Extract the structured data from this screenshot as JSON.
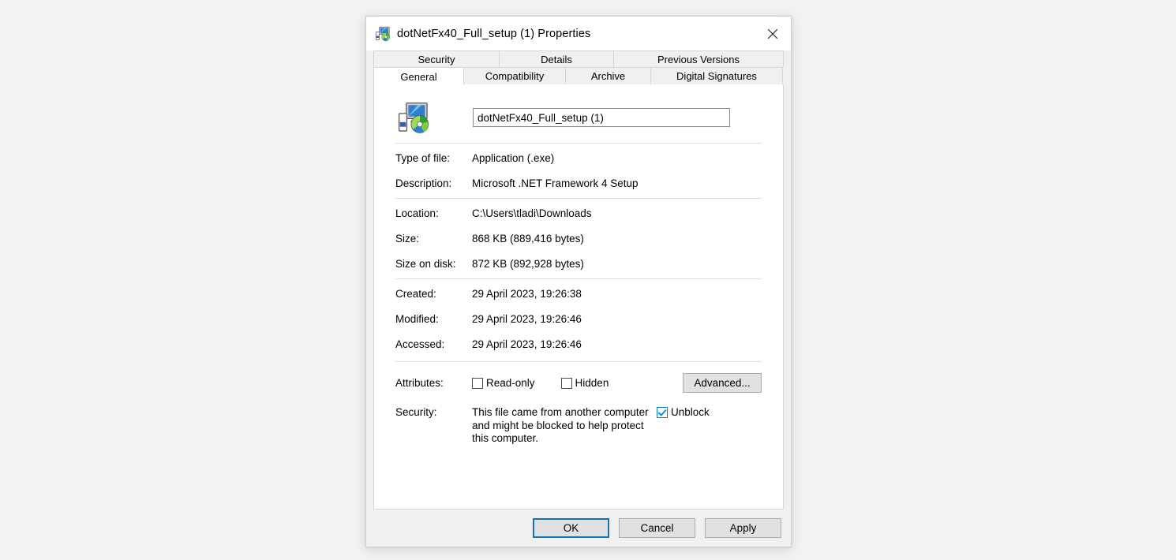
{
  "window": {
    "title": "dotNetFx40_Full_setup (1) Properties",
    "icon": "setup-application-icon",
    "close_label": "✕",
    "accent_color": "#1172b8"
  },
  "tabs": {
    "row1": [
      {
        "label": "Security",
        "active": false
      },
      {
        "label": "Details",
        "active": false
      },
      {
        "label": "Previous Versions",
        "active": false
      }
    ],
    "row2": [
      {
        "label": "General",
        "active": true
      },
      {
        "label": "Compatibility",
        "active": false
      },
      {
        "label": "Archive",
        "active": false
      },
      {
        "label": "Digital Signatures",
        "active": false
      }
    ]
  },
  "general": {
    "filename_value": "dotNetFx40_Full_setup (1)",
    "properties": [
      {
        "label": "Type of file:",
        "value": "Application (.exe)"
      },
      {
        "label": "Description:",
        "value": "Microsoft .NET Framework 4 Setup"
      },
      {
        "label": "Location:",
        "value": "C:\\Users\\tladi\\Downloads"
      },
      {
        "label": "Size:",
        "value": "868 KB (889,416 bytes)"
      },
      {
        "label": "Size on disk:",
        "value": "872 KB (892,928 bytes)"
      },
      {
        "label": "Created:",
        "value": "29 April 2023, 19:26:38"
      },
      {
        "label": "Modified:",
        "value": "29 April 2023, 19:26:46"
      },
      {
        "label": "Accessed:",
        "value": "29 April 2023, 19:26:46"
      }
    ],
    "attributes": {
      "label": "Attributes:",
      "readonly_label": "Read-only",
      "readonly_checked": false,
      "hidden_label": "Hidden",
      "hidden_checked": false,
      "advanced_label": "Advanced..."
    },
    "security": {
      "label": "Security:",
      "message": "This file came from another computer and might be blocked to help protect this computer.",
      "unblock_label": "Unblock",
      "unblock_checked": true
    }
  },
  "footer": {
    "ok_label": "OK",
    "cancel_label": "Cancel",
    "apply_label": "Apply"
  }
}
